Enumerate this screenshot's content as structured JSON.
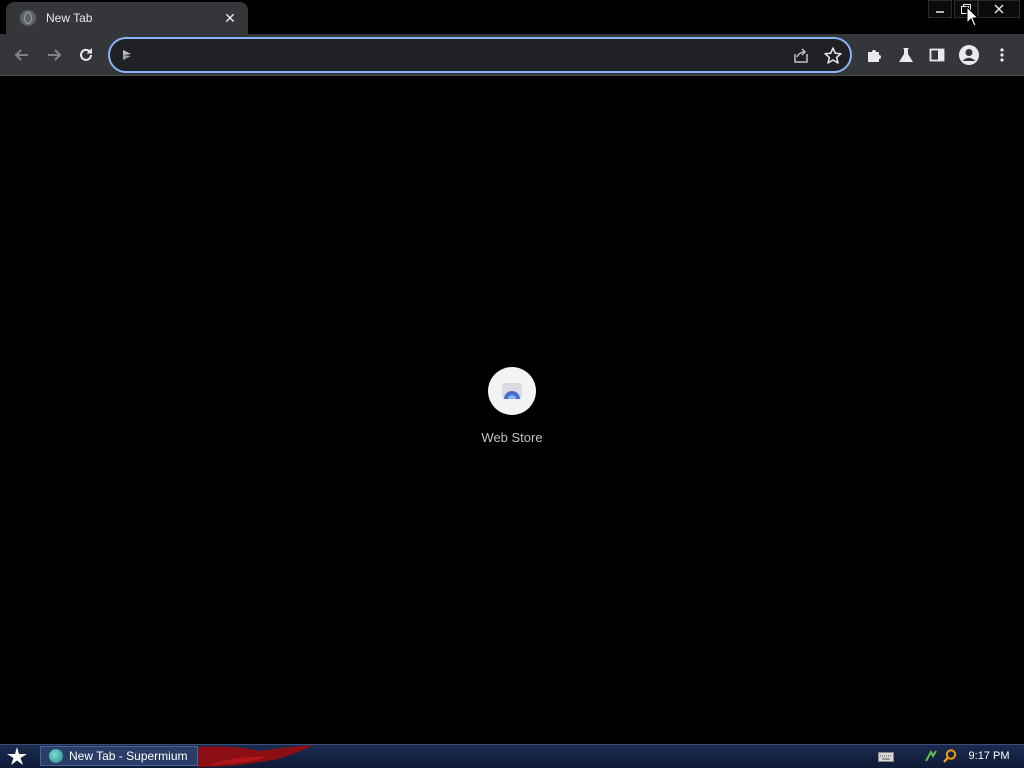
{
  "browser": {
    "tab": {
      "title": "New Tab",
      "close_symbol": "✕"
    },
    "window_controls": {
      "minimize_symbol": "—",
      "maximize_symbol": "⧉",
      "close_symbol": "✕"
    },
    "toolbar": {
      "back_icon": "arrow-left-icon",
      "forward_icon": "arrow-right-icon",
      "reload_icon": "reload-icon",
      "omnibox": {
        "value": "",
        "placeholder": ""
      },
      "extensions_icon": "puzzle-icon",
      "labs_icon": "flask-icon",
      "side_panel_icon": "side-panel-icon",
      "profile_icon": "avatar-icon",
      "menu_icon": "kebab-menu-icon"
    },
    "accent_color": "#8ab4f8"
  },
  "new_tab": {
    "shortcuts": [
      {
        "label": "Web Store",
        "icon": "web-store-icon"
      }
    ]
  },
  "taskbar": {
    "start_icon": "star-icon",
    "items": [
      {
        "label": "New Tab - Supermium",
        "icon": "supermium-icon"
      }
    ],
    "clock": "9:17 PM"
  }
}
